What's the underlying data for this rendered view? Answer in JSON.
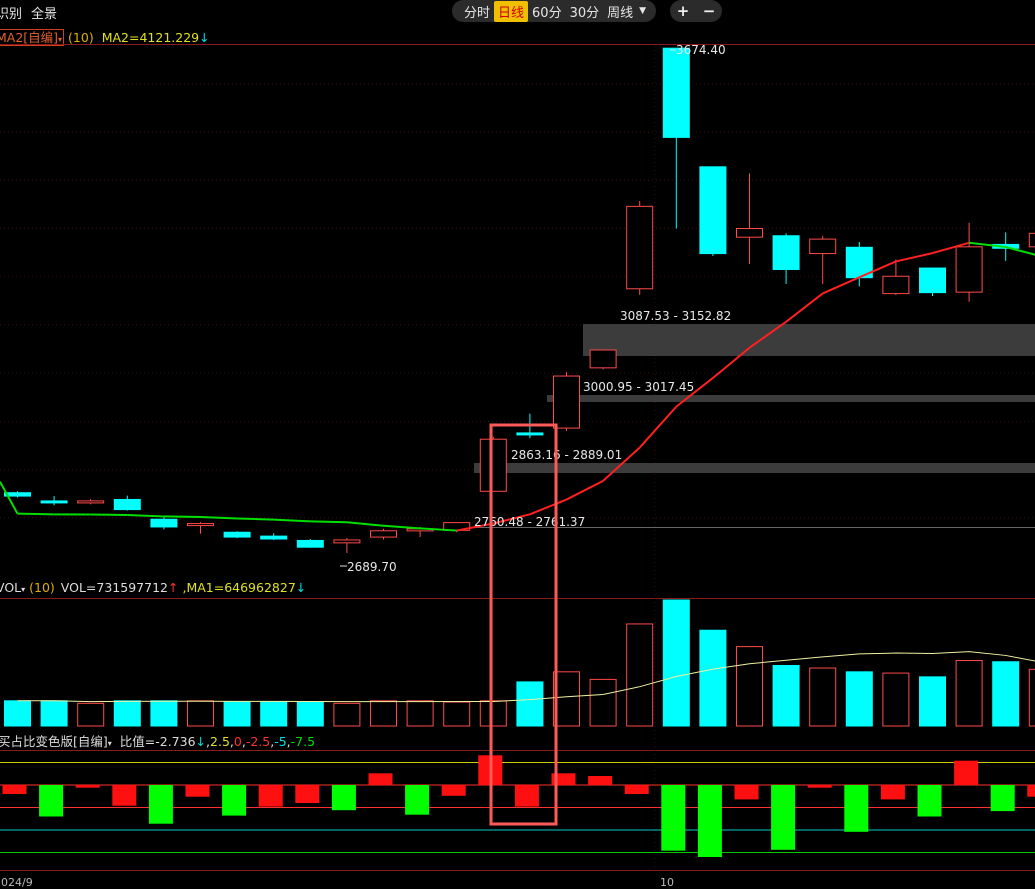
{
  "menu": {
    "item_left": "识别",
    "item_full": "全景"
  },
  "periods": [
    "分时",
    "日线",
    "60分",
    "30分",
    "周线"
  ],
  "active_period": "日线",
  "zoom": {
    "plus": "+",
    "minus": "−"
  },
  "price_panel": {
    "indicator_name": "MA2[自编]",
    "param": "(10)",
    "value_text": "MA2=4121.229",
    "value_arrow": "↓",
    "high_label": "3674.40",
    "low_label": "2689.70",
    "zone_labels": [
      "3087.53 - 3152.82",
      "3000.95 - 3017.45",
      "2863.16 - 2889.01",
      "2760.48 - 2761.37"
    ]
  },
  "volume_panel": {
    "indicator_name": "VOL",
    "param": "(10)",
    "vol_text": "VOL=731597712",
    "vol_arrow": "↑",
    "ma_text": "MA1=646962827",
    "ma_arrow": "↓"
  },
  "ratio_panel": {
    "indicator_name": "买占比变色版[自编]",
    "value_text": "比值=-2.736",
    "value_arrow": "↓",
    "levels": [
      "2.5",
      "0",
      "-2.5",
      "-5",
      "-7.5"
    ]
  },
  "date_labels": [
    "2024/9",
    "10"
  ],
  "colors": {
    "up": "#ff4a4a",
    "down": "#00ffff",
    "ma_up": "#ff2020",
    "ma_down": "#00e000",
    "highlight_box": "#ff5a5a"
  },
  "chart_data": {
    "type": "candlestick",
    "candles": [
      {
        "o": 2752,
        "h": 2755,
        "l": 2742,
        "c": 2745
      },
      {
        "o": 2735,
        "h": 2745,
        "l": 2726,
        "c": 2732
      },
      {
        "o": 2733,
        "h": 2739,
        "l": 2728,
        "c": 2735
      },
      {
        "o": 2738,
        "h": 2746,
        "l": 2715,
        "c": 2717
      },
      {
        "o": 2697,
        "h": 2702,
        "l": 2676,
        "c": 2681
      },
      {
        "o": 2685,
        "h": 2691,
        "l": 2667,
        "c": 2688
      },
      {
        "o": 2670,
        "h": 2672,
        "l": 2658,
        "c": 2660
      },
      {
        "o": 2662,
        "h": 2668,
        "l": 2654,
        "c": 2656
      },
      {
        "o": 2653,
        "h": 2656,
        "l": 2638,
        "c": 2639
      },
      {
        "o": 2648,
        "h": 2658,
        "l": 2627,
        "c": 2654
      },
      {
        "o": 2660,
        "h": 2677,
        "l": 2655,
        "c": 2673
      },
      {
        "o": 2673,
        "h": 2681,
        "l": 2660,
        "c": 2677
      },
      {
        "o": 2674,
        "h": 2691,
        "l": 2670,
        "c": 2690
      },
      {
        "o": 2755,
        "h": 2868,
        "l": 2755,
        "c": 2863
      },
      {
        "o": 2876,
        "h": 2916,
        "l": 2865,
        "c": 2872
      },
      {
        "o": 2886,
        "h": 3002,
        "l": 2880,
        "c": 2994
      },
      {
        "o": 3011,
        "h": 3048,
        "l": 3008,
        "c": 3048
      },
      {
        "o": 3175,
        "h": 3357,
        "l": 3162,
        "c": 3346
      },
      {
        "o": 3674,
        "h": 3674,
        "l": 3300,
        "c": 3489
      },
      {
        "o": 3428,
        "h": 3428,
        "l": 3243,
        "c": 3248
      },
      {
        "o": 3282,
        "h": 3414,
        "l": 3226,
        "c": 3300
      },
      {
        "o": 3285,
        "h": 3290,
        "l": 3185,
        "c": 3215
      },
      {
        "o": 3248,
        "h": 3285,
        "l": 3185,
        "c": 3278
      },
      {
        "o": 3261,
        "h": 3272,
        "l": 3180,
        "c": 3198
      },
      {
        "o": 3165,
        "h": 3236,
        "l": 3162,
        "c": 3201
      },
      {
        "o": 3218,
        "h": 3218,
        "l": 3160,
        "c": 3167
      },
      {
        "o": 3168,
        "h": 3312,
        "l": 3148,
        "c": 3262
      },
      {
        "o": 3267,
        "h": 3292,
        "l": 3233,
        "c": 3259
      },
      {
        "o": 3262,
        "h": 3290,
        "l": 3240,
        "c": 3290
      }
    ],
    "volume_ma_label": "MA1",
    "volume": [
      40,
      40,
      36,
      40,
      40,
      40,
      38,
      38,
      38,
      36,
      40,
      40,
      38,
      40,
      70,
      86,
      74,
      162,
      200,
      152,
      126,
      96,
      92,
      86,
      84,
      78,
      104,
      102,
      90
    ],
    "ratio": [
      -1.0,
      -3.5,
      -0.3,
      -2.3,
      -4.3,
      -1.3,
      -3.4,
      -2.4,
      -2.0,
      -2.8,
      1.3,
      -3.3,
      -1.2,
      3.3,
      -2.4,
      1.3,
      1.0,
      -1.0,
      -7.3,
      -8.0,
      -1.6,
      -7.2,
      -0.3,
      -5.2,
      -1.6,
      -3.5,
      2.7,
      -2.9,
      -1.3
    ]
  }
}
